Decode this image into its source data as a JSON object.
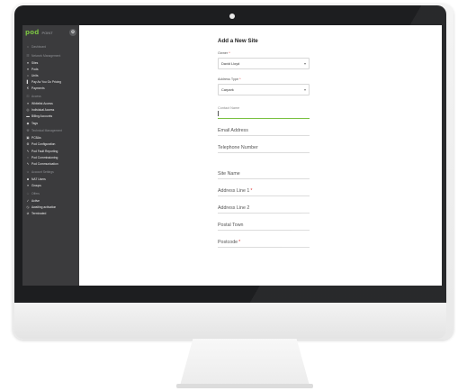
{
  "app": {
    "brand": "pod",
    "brand_sub": "POINT",
    "toggle_icon": "gear-icon"
  },
  "sidebar": {
    "items": [
      {
        "label": "Dashboard",
        "icon": "home-icon",
        "section": true
      },
      {
        "label": "Network Management",
        "icon": "network-icon",
        "section": true
      },
      {
        "label": "Sites",
        "icon": "globe-icon",
        "section": false
      },
      {
        "label": "Pods",
        "icon": "pin-icon",
        "section": false
      },
      {
        "label": "Units",
        "icon": "circle-icon",
        "section": false
      },
      {
        "label": "Pay As You Go Pricing",
        "icon": "chart-icon",
        "section": false
      },
      {
        "label": "Payments",
        "icon": "currency-icon",
        "section": false
      },
      {
        "label": "Access",
        "icon": "key-icon",
        "section": true
      },
      {
        "label": "Whitelist Access",
        "icon": "list-icon",
        "section": false
      },
      {
        "label": "Individual Access",
        "icon": "user-circle-icon",
        "section": false
      },
      {
        "label": "Billing Accounts",
        "icon": "card-icon",
        "section": false
      },
      {
        "label": "Tags",
        "icon": "tag-icon",
        "section": false
      },
      {
        "label": "Technical Management",
        "icon": "wrench-icon",
        "section": true
      },
      {
        "label": "PCBAs",
        "icon": "chip-icon",
        "section": false
      },
      {
        "label": "Pod Configuration",
        "icon": "gear-icon",
        "section": false
      },
      {
        "label": "Pod Fault Reporting",
        "icon": "bolt-icon",
        "section": false
      },
      {
        "label": "Pod Commissioning",
        "icon": "ring-icon",
        "section": false
      },
      {
        "label": "Pod Communication",
        "icon": "bolt-icon",
        "section": false
      },
      {
        "label": "Account Settings",
        "icon": "user-icon",
        "section": true
      },
      {
        "label": "NAT Users",
        "icon": "users-icon",
        "section": false
      },
      {
        "label": "Groups",
        "icon": "list-icon",
        "section": false
      },
      {
        "label": "Offers",
        "icon": "star-icon",
        "section": true
      },
      {
        "label": "Active",
        "icon": "check-circle-icon",
        "section": false
      },
      {
        "label": "Awaiting activation",
        "icon": "clock-icon",
        "section": false
      },
      {
        "label": "Terminated",
        "icon": "ban-icon",
        "section": false
      }
    ]
  },
  "form": {
    "title": "Add a New Site",
    "owner_label": "Owner",
    "owner_value": "David Lloyd",
    "address_type_label": "Address Type",
    "address_type_value": "Carpark",
    "contact_name_label": "Contact Name",
    "email_placeholder": "Email Address",
    "telephone_placeholder": "Telephone Number",
    "site_name_placeholder": "Site Name",
    "address1_placeholder": "Address Line 1",
    "address2_placeholder": "Address Line 2",
    "postal_town_placeholder": "Postal Town",
    "postcode_placeholder": "Postcode",
    "required_mark": "*"
  },
  "colors": {
    "sidebar_bg": "#3b3b3d",
    "accent": "#7ac142",
    "bezel": "#1d1e20"
  }
}
